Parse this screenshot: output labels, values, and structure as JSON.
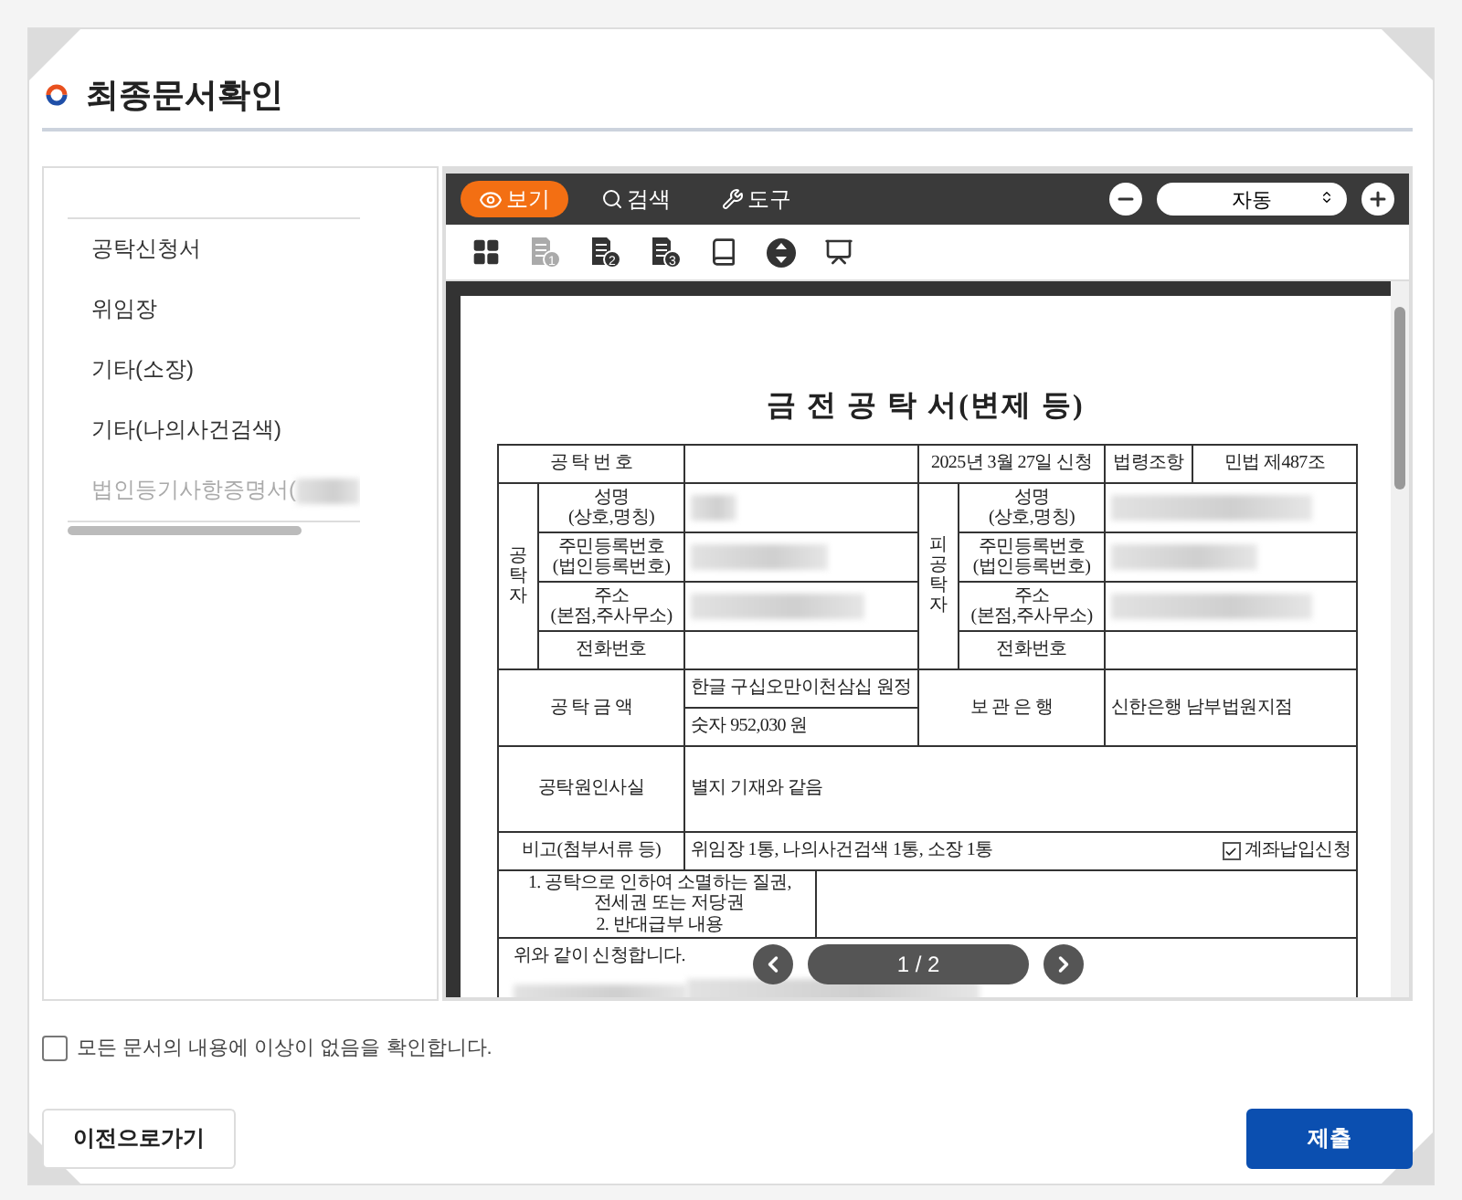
{
  "page": {
    "title": "최종문서확인"
  },
  "documents": [
    {
      "label": "공탁신청서",
      "disabled": false
    },
    {
      "label": "위임장",
      "disabled": false
    },
    {
      "label": "기타(소장)",
      "disabled": false
    },
    {
      "label": "기타(나의사건검색)",
      "disabled": false
    },
    {
      "label": "법인등기사항증명서(",
      "disabled": true
    }
  ],
  "viewer": {
    "tabs": [
      {
        "label": "보기",
        "kind": "view",
        "selected": true
      },
      {
        "label": "검색",
        "kind": "search",
        "selected": false
      },
      {
        "label": "도구",
        "kind": "tools",
        "selected": false
      }
    ],
    "zoom": "자동",
    "tools": [
      {
        "kind": "grid",
        "selected": false
      },
      {
        "kind": "page",
        "badge": "1",
        "selected": true
      },
      {
        "kind": "page",
        "badge": "2",
        "selected": false
      },
      {
        "kind": "page",
        "badge": "3",
        "selected": false
      },
      {
        "kind": "book",
        "selected": false
      },
      {
        "kind": "scroll",
        "selected": false
      },
      {
        "kind": "presentation",
        "selected": false
      }
    ],
    "pager": "1 / 2"
  },
  "document": {
    "title": "금 전 공 탁 서(변제 등)",
    "number_label": "공 탁 번 호",
    "date": "2025년 3월 27일 신청",
    "law_label": "법령조항",
    "law": "민법 제487조",
    "parties": [
      {
        "side": "공탁자",
        "fields": [
          {
            "label": [
              "성명",
              "(상호,명칭)"
            ],
            "redacted": true
          },
          {
            "label": [
              "주민등록번호",
              "(법인등록번호)"
            ],
            "redacted": true
          },
          {
            "label": [
              "주소",
              "(본점,주사무소)"
            ],
            "redacted": true
          },
          {
            "label": [
              "전화번호"
            ],
            "redacted": false
          }
        ]
      },
      {
        "side": "피공탁자",
        "fields": [
          {
            "label": [
              "성명",
              "(상호,명칭)"
            ],
            "redacted": true
          },
          {
            "label": [
              "주민등록번호",
              "(법인등록번호)"
            ],
            "redacted": true
          },
          {
            "label": [
              "주소",
              "(본점,주사무소)"
            ],
            "redacted": true
          },
          {
            "label": [
              "전화번호"
            ],
            "redacted": false
          }
        ]
      }
    ],
    "amount_label": "공 탁 금 액",
    "amount_words": "한글 구십오만이천삼십 원정",
    "amount_number": "숫자 952,030 원",
    "bank_label": "보 관 은 행",
    "bank": "신한은행 남부법원지점",
    "cause_label": "공탁원인사실",
    "cause": "별지 기재와 같음",
    "note_label": "비고(첨부서류 등)",
    "note": "위임장 1통, 나의사건검색 1통, 소장 1통",
    "account_option": {
      "label": "계좌납입신청",
      "checked": true
    },
    "extra_items": [
      "1. 공탁으로 인하여 소멸하는 질권,",
      "전세권 또는 저당권",
      "2. 반대급부 내용"
    ],
    "closing": "위와 같이 신청합니다."
  },
  "confirm": {
    "label": "모든 문서의 내용에 이상이 없음을 확인합니다.",
    "checked": false
  },
  "buttons": [
    {
      "kind": "secondary",
      "label": "이전으로가기"
    },
    {
      "kind": "primary",
      "label": "제출"
    }
  ]
}
